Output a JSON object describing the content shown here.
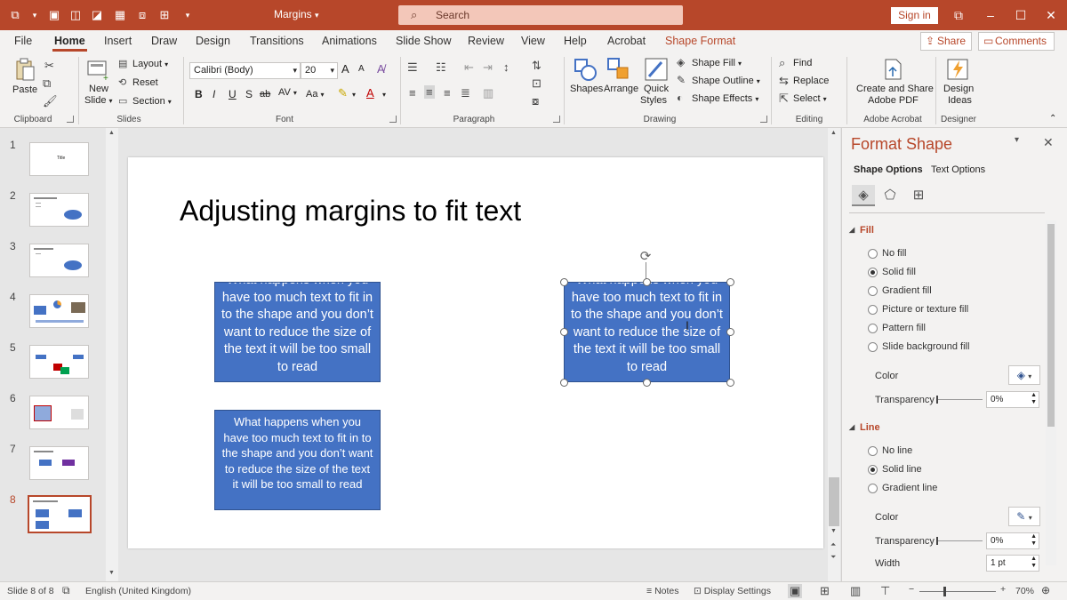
{
  "window": {
    "title": "Margins",
    "search_placeholder": "Search",
    "sign_in": "Sign in"
  },
  "ribbon_tabs": [
    "File",
    "Home",
    "Insert",
    "Draw",
    "Design",
    "Transitions",
    "Animations",
    "Slide Show",
    "Review",
    "View",
    "Help",
    "Acrobat",
    "Shape Format"
  ],
  "active_tab": "Home",
  "share_label": "Share",
  "comments_label": "Comments",
  "ribbon": {
    "clipboard": {
      "paste": "Paste",
      "group": "Clipboard"
    },
    "slides": {
      "new_slide_1": "New",
      "new_slide_2": "Slide",
      "layout": "Layout",
      "reset": "Reset",
      "section": "Section",
      "group": "Slides"
    },
    "font": {
      "name": "Calibri (Body)",
      "size": "20",
      "group": "Font",
      "bold": "B",
      "italic": "I",
      "underline": "U",
      "shadow": "S",
      "strike": "ab",
      "spacing": "AV",
      "case": "Aa",
      "grow": "A",
      "shrink": "A"
    },
    "paragraph": {
      "group": "Paragraph"
    },
    "drawing": {
      "shapes": "Shapes",
      "arrange": "Arrange",
      "quick_styles_1": "Quick",
      "quick_styles_2": "Styles",
      "fill": "Shape Fill",
      "outline": "Shape Outline",
      "effects": "Shape Effects",
      "group": "Drawing"
    },
    "editing": {
      "find": "Find",
      "replace": "Replace",
      "select": "Select",
      "group": "Editing"
    },
    "acrobat": {
      "line1": "Create and Share",
      "line2": "Adobe PDF",
      "group": "Adobe Acrobat"
    },
    "designer": {
      "line1": "Design",
      "line2": "Ideas",
      "group": "Designer"
    }
  },
  "thumbnails": [
    {
      "num": "1",
      "title": "Title"
    },
    {
      "num": "2",
      "title": ""
    },
    {
      "num": "3",
      "title": ""
    },
    {
      "num": "4",
      "title": ""
    },
    {
      "num": "5",
      "title": ""
    },
    {
      "num": "6",
      "title": ""
    },
    {
      "num": "7",
      "title": ""
    },
    {
      "num": "8",
      "title": ""
    }
  ],
  "selected_slide": 8,
  "slide": {
    "title": "Adjusting margins to fit text",
    "shape_text_1": "What happens when you have too much text to fit in to the shape and you don’t want to reduce the size of the text it will be too small to read",
    "shape_text_2": "What happens when you have too much text to fit in to the shape and you don’t want to reduce the size of the text it will be too small to read",
    "shape_text_3": "What happens when you have too much text to fit in to the shape and you don’t want to reduce the size of the text it will be too small to read",
    "shape_fill": "#4472c4"
  },
  "format_pane": {
    "title": "Format Shape",
    "tab_shape": "Shape Options",
    "tab_text": "Text Options",
    "fill_section": "Fill",
    "fill_options": [
      "No fill",
      "Solid fill",
      "Gradient fill",
      "Picture or texture fill",
      "Pattern fill",
      "Slide background fill"
    ],
    "fill_selected": "Solid fill",
    "color_label": "Color",
    "transparency_label": "Transparency",
    "transparency_value": "0%",
    "line_section": "Line",
    "line_options": [
      "No line",
      "Solid line",
      "Gradient line"
    ],
    "line_selected": "Solid line",
    "line_color_label": "Color",
    "line_transparency_label": "Transparency",
    "line_transparency_value": "0%",
    "width_label": "Width",
    "width_value": "1 pt"
  },
  "status": {
    "slide_of": "Slide 8 of 8",
    "language": "English (United Kingdom)",
    "notes": "Notes",
    "display_settings": "Display Settings",
    "zoom": "70%"
  },
  "colors": {
    "accent": "#b7472a",
    "shape": "#4472c4"
  }
}
